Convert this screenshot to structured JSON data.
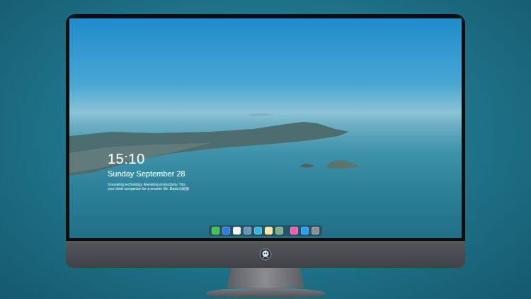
{
  "lock_screen": {
    "time": "15:10",
    "date": "Sunday September 28",
    "tagline": [
      "Innovating technology. Elevating productivity. Yitu,",
      "your ideal companion for a smarter life. Basic功能版"
    ]
  },
  "dock": {
    "groups": [
      {
        "items": [
          {
            "color": "#3fc24f"
          },
          {
            "color": "#2f7be0"
          },
          {
            "color": "#f2f2f2"
          },
          {
            "color": "#6f90b8"
          },
          {
            "color": "#38b6d8"
          },
          {
            "color": "#f5e7a0"
          },
          {
            "color": "#7fae8c"
          }
        ]
      },
      {
        "items": [
          {
            "color": "#f05fa8"
          },
          {
            "color": "#2a9df4"
          },
          {
            "color": "#8c8f96"
          }
        ]
      }
    ]
  }
}
